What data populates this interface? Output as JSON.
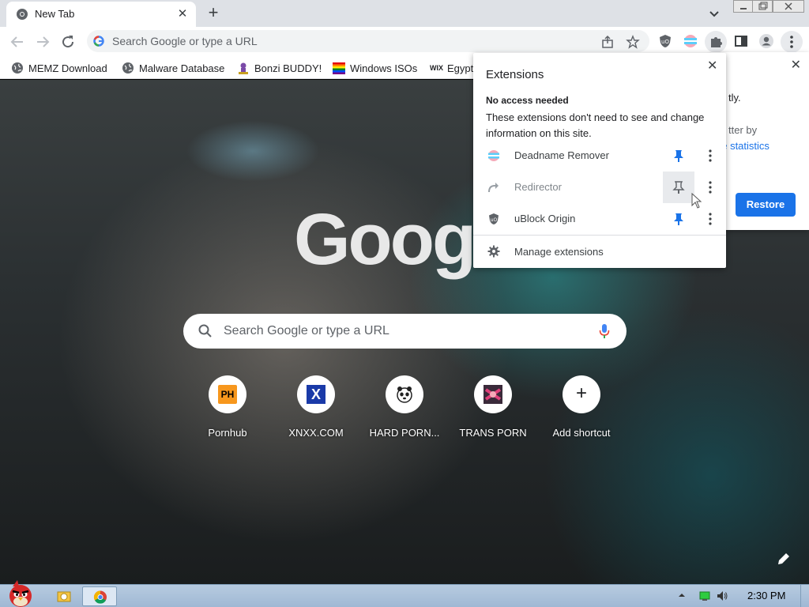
{
  "browser": {
    "tab": {
      "title": "New Tab",
      "close_glyph": "✕"
    },
    "newtab_glyph": "+",
    "omnibox": {
      "placeholder": "Search Google or type a URL"
    },
    "bookmarks": [
      {
        "label": "MEMZ Download",
        "icon": "globe-icon"
      },
      {
        "label": "Malware Database",
        "icon": "globe-icon"
      },
      {
        "label": "Bonzi BUDDY!",
        "icon": "bonzi-icon"
      },
      {
        "label": "Windows ISOs",
        "icon": "rainbow-flag-icon"
      },
      {
        "label": "Egypt",
        "icon": "wix-icon",
        "icon_text": "WIX"
      }
    ]
  },
  "ntp": {
    "logo": "Google",
    "search_placeholder": "Search Google or type a URL",
    "shortcuts": [
      {
        "label": "Pornhub",
        "icon_text": "PH"
      },
      {
        "label": "XNXX.COM",
        "icon_text": "X"
      },
      {
        "label": "HARD PORN...",
        "icon_text": ""
      },
      {
        "label": "TRANS PORN",
        "icon_text": ""
      },
      {
        "label": "Add shortcut",
        "icon_text": "+"
      }
    ]
  },
  "restore_panel": {
    "close_glyph": "✕",
    "text_1": "tly.",
    "text_2": "tter by",
    "link_text": "ge statistics",
    "button_label": "Restore"
  },
  "extensions_menu": {
    "title": "Extensions",
    "close_glyph": "✕",
    "section_heading": "No access needed",
    "section_desc": "These extensions don't need to see and change information on this site.",
    "items": [
      {
        "name": "Deadname Remover",
        "pinned": true,
        "enabled": true
      },
      {
        "name": "Redirector",
        "pinned": false,
        "enabled": false
      },
      {
        "name": "uBlock Origin",
        "pinned": true,
        "enabled": true
      }
    ],
    "manage_label": "Manage extensions"
  },
  "taskbar": {
    "clock": "2:30 PM"
  },
  "colors": {
    "accent_blue": "#1a73e8",
    "tab_strip": "#dee1e6",
    "taskbar": "#9fb8d4"
  }
}
